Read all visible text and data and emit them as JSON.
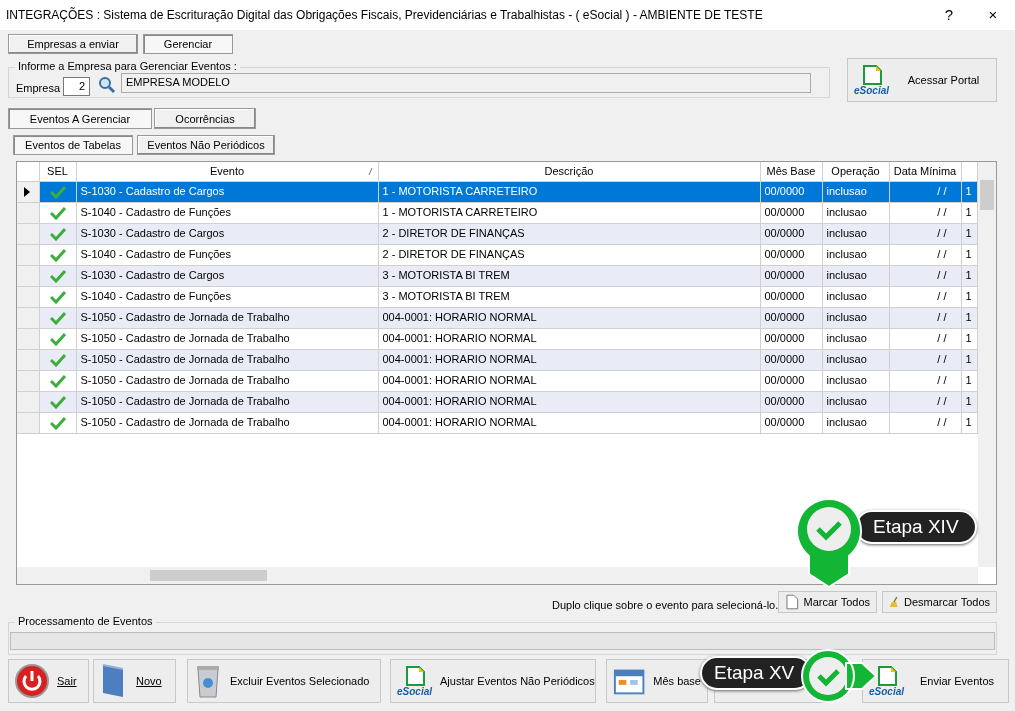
{
  "window": {
    "title": "INTEGRAÇÕES : Sistema de Escrituração Digital das Obrigações Fiscais, Previdenciárias e Trabalhistas - ( eSocial ) - AMBIENTE DE TESTE",
    "help": "?",
    "close": "×"
  },
  "top_tabs": [
    {
      "label": "Empresas a enviar",
      "selected": false
    },
    {
      "label": "Gerenciar",
      "selected": true
    }
  ],
  "company_group": {
    "legend": "Informe a Empresa para Gerenciar Eventos :",
    "label": "Empresa",
    "code": "2",
    "name": "EMPRESA MODELO"
  },
  "portal_button": {
    "logo": "eSocial",
    "label": "Acessar Portal"
  },
  "event_tabs": [
    {
      "label": "Eventos A Gerenciar",
      "selected": true
    },
    {
      "label": "Ocorrências",
      "selected": false
    }
  ],
  "sub_tabs": [
    {
      "label": "Eventos de Tabelas",
      "selected": true
    },
    {
      "label": "Eventos Não Periódicos",
      "selected": false
    }
  ],
  "table": {
    "columns": [
      {
        "label": "SEL",
        "sorted": false
      },
      {
        "label": "Evento",
        "sorted": true
      },
      {
        "label": "Descrição",
        "sorted": false
      },
      {
        "label": "Mês Base",
        "sorted": false
      },
      {
        "label": "Operação",
        "sorted": false
      },
      {
        "label": "Data Mínima",
        "sorted": false
      }
    ],
    "rows": [
      {
        "selected": true,
        "checked": true,
        "evento": "S-1030 - Cadastro de Cargos",
        "descricao": "1 - MOTORISTA CARRETEIRO",
        "mes_base": "00/0000",
        "operacao": "inclusao",
        "data_minima": "/ /",
        "column_8": "1"
      },
      {
        "selected": false,
        "checked": true,
        "evento": "S-1040 - Cadastro de Funções",
        "descricao": "1 - MOTORISTA CARRETEIRO",
        "mes_base": "00/0000",
        "operacao": "inclusao",
        "data_minima": "/ /",
        "column_8": "1"
      },
      {
        "selected": false,
        "checked": true,
        "evento": "S-1030 - Cadastro de Cargos",
        "descricao": "2 - DIRETOR DE FINANÇAS",
        "mes_base": "00/0000",
        "operacao": "inclusao",
        "data_minima": "/ /",
        "column_8": "1"
      },
      {
        "selected": false,
        "checked": true,
        "evento": "S-1040 - Cadastro de Funções",
        "descricao": "2 - DIRETOR DE FINANÇAS",
        "mes_base": "00/0000",
        "operacao": "inclusao",
        "data_minima": "/ /",
        "column_8": "1"
      },
      {
        "selected": false,
        "checked": true,
        "evento": "S-1030 - Cadastro de Cargos",
        "descricao": "3 - MOTORISTA BI TREM",
        "mes_base": "00/0000",
        "operacao": "inclusao",
        "data_minima": "/ /",
        "column_8": "1"
      },
      {
        "selected": false,
        "checked": true,
        "evento": "S-1040 - Cadastro de Funções",
        "descricao": "3 - MOTORISTA BI TREM",
        "mes_base": "00/0000",
        "operacao": "inclusao",
        "data_minima": "/ /",
        "column_8": "1"
      },
      {
        "selected": false,
        "checked": true,
        "evento": "S-1050 - Cadastro de Jornada de Trabalho",
        "descricao": "004-0001: HORARIO NORMAL",
        "mes_base": "00/0000",
        "operacao": "inclusao",
        "data_minima": "/ /",
        "column_8": "1"
      },
      {
        "selected": false,
        "checked": true,
        "evento": "S-1050 - Cadastro de Jornada de Trabalho",
        "descricao": "004-0001: HORARIO NORMAL",
        "mes_base": "00/0000",
        "operacao": "inclusao",
        "data_minima": "/ /",
        "column_8": "1"
      },
      {
        "selected": false,
        "checked": true,
        "evento": "S-1050 - Cadastro de Jornada de Trabalho",
        "descricao": "004-0001: HORARIO NORMAL",
        "mes_base": "00/0000",
        "operacao": "inclusao",
        "data_minima": "/ /",
        "column_8": "1"
      },
      {
        "selected": false,
        "checked": true,
        "evento": "S-1050 - Cadastro de Jornada de Trabalho",
        "descricao": "004-0001: HORARIO NORMAL",
        "mes_base": "00/0000",
        "operacao": "inclusao",
        "data_minima": "/ /",
        "column_8": "1"
      },
      {
        "selected": false,
        "checked": true,
        "evento": "S-1050 - Cadastro de Jornada de Trabalho",
        "descricao": "004-0001: HORARIO NORMAL",
        "mes_base": "00/0000",
        "operacao": "inclusao",
        "data_minima": "/ /",
        "column_8": "1"
      },
      {
        "selected": false,
        "checked": true,
        "evento": "S-1050 - Cadastro de Jornada de Trabalho",
        "descricao": "004-0001: HORARIO NORMAL",
        "mes_base": "00/0000",
        "operacao": "inclusao",
        "data_minima": "/ /",
        "column_8": "1"
      }
    ]
  },
  "hint": "Duplo clique sobre o evento para selecioná-lo.",
  "select_buttons": [
    {
      "kind": "page",
      "label": "Marcar Todos"
    },
    {
      "kind": "broom",
      "label": "Desmarcar Todos"
    }
  ],
  "progress": {
    "legend": "Processamento de Eventos",
    "level": 0
  },
  "bottom_buttons": [
    {
      "kind": "power",
      "label": "Sair"
    },
    {
      "kind": "book",
      "label": "Novo"
    },
    {
      "kind": "trash",
      "label": "Excluir Eventos Selecionado"
    },
    {
      "kind": "esocial",
      "label": "Ajustar Eventos Não Periódicos",
      "logo": "eSocial"
    },
    {
      "kind": "calendar",
      "label": "Mês base"
    },
    {
      "kind": "hidden"
    },
    {
      "kind": "esocial",
      "label": "Enviar Eventos",
      "logo": "eSocial"
    }
  ],
  "callouts": [
    {
      "kind": "pin",
      "label": "Etapa XIV"
    },
    {
      "kind": "arrow",
      "label": "Etapa XV"
    }
  ]
}
